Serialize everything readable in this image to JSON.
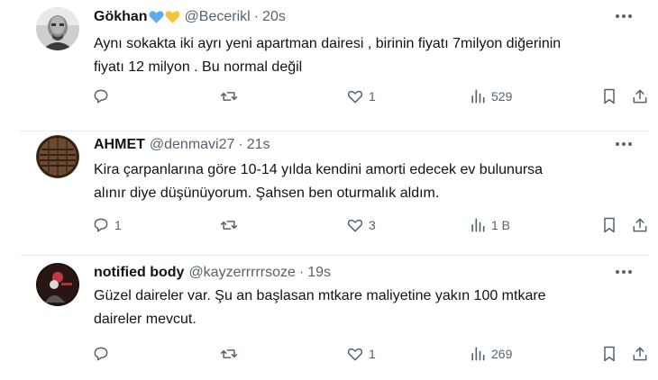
{
  "tweets": [
    {
      "name": "Gökhan",
      "handle": "@Becerikl",
      "separator": "·",
      "time": "20s",
      "text_lines": [
        "Aynı sokakta iki ayrı yeni apartman dairesi , birinin fiyatı 7milyon diğerinin",
        "fiyatı 12 milyon . Bu normal değil"
      ],
      "replies": "",
      "retweets": "",
      "likes": "1",
      "views": "529"
    },
    {
      "name": "AHMET",
      "handle": "@denmavi27",
      "separator": "·",
      "time": "21s",
      "text_lines": [
        "Kira çarpanlarına göre 10-14 yılda kendini amorti edecek ev bulunursa",
        "alınır diye düşünüyorum. Şahsen ben oturmalık aldım."
      ],
      "replies": "1",
      "retweets": "",
      "likes": "3",
      "views": "1 B"
    },
    {
      "name": "notified body",
      "handle": "@kayzerrrrrsoze",
      "separator": "·",
      "time": "19s",
      "text_lines": [
        "Güzel daireler var. Şu an başlasan mtkare maliyetine yakın 100 mtkare",
        "daireler mevcut."
      ],
      "replies": "",
      "retweets": "",
      "likes": "1",
      "views": "269"
    }
  ],
  "colors": {
    "text": "#0f1419",
    "muted": "#536471",
    "border": "#e6ecf0",
    "blue_heart": "#5dadec",
    "yellow_heart": "#f5c33b"
  },
  "icons": [
    "reply-icon",
    "retweet-icon",
    "like-icon",
    "views-icon",
    "bookmark-icon",
    "share-icon",
    "more-icon"
  ]
}
